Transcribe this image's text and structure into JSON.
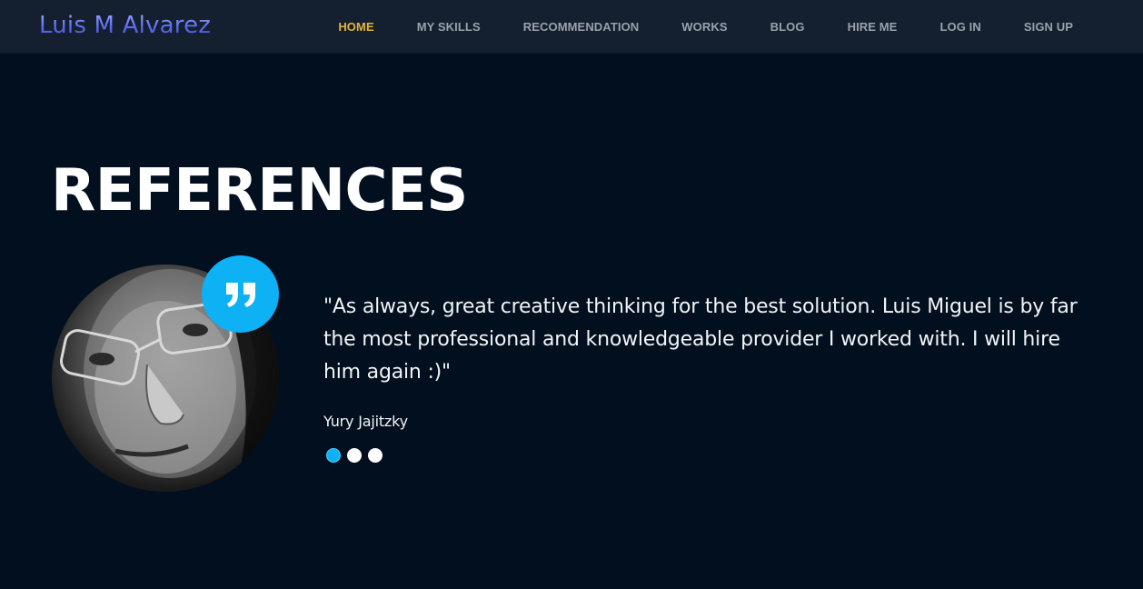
{
  "brand": {
    "name": "Luis M Alvarez"
  },
  "nav": {
    "items": [
      {
        "label": "HOME",
        "active": true
      },
      {
        "label": "MY SKILLS",
        "active": false
      },
      {
        "label": "RECOMMENDATION",
        "active": false
      },
      {
        "label": "WORKS",
        "active": false
      },
      {
        "label": "BLOG",
        "active": false
      },
      {
        "label": "HIRE ME",
        "active": false
      },
      {
        "label": "LOG IN",
        "active": false
      },
      {
        "label": "SIGN UP",
        "active": false
      }
    ]
  },
  "references": {
    "title": "REFERENCES",
    "quote_icon": "quote-icon",
    "avatar_icon": "person-photo",
    "quote": "\"As always, great creative thinking for the best solution. Luis Miguel is by far the most professional and knowledgeable provider I worked with. I will hire him again :)\"",
    "author": "Yury Jajitzky",
    "slides_total": 3,
    "active_slide": 1
  },
  "colors": {
    "background": "#020f1e",
    "navbar": "#14202f",
    "nav_active": "#e3b23c",
    "accent": "#0db1f4"
  }
}
